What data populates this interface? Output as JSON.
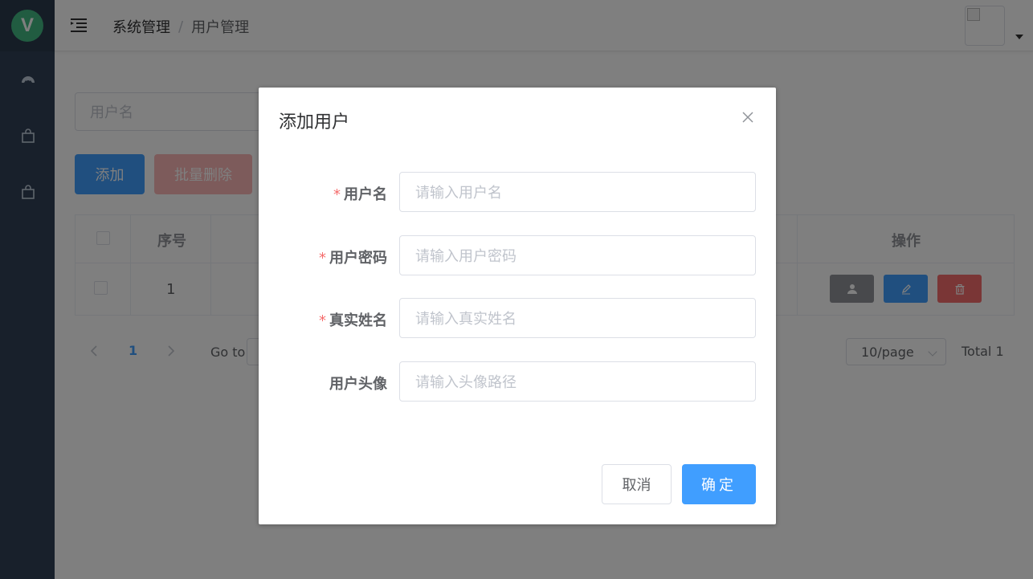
{
  "sidebar": {
    "logo_letter": "V",
    "items": [
      {
        "icon": "dashboard-icon"
      },
      {
        "icon": "shopping-bag-icon"
      },
      {
        "icon": "shopping-bag-icon"
      }
    ]
  },
  "header": {
    "breadcrumb": [
      "系统管理",
      "用户管理"
    ],
    "separator": "/"
  },
  "toolbar": {
    "search_placeholder": "用户名",
    "add_label": "添加",
    "batch_delete_label": "批量删除"
  },
  "table": {
    "columns": [
      "序号",
      "操作"
    ],
    "rows": [
      {
        "index": "1"
      }
    ]
  },
  "pagination": {
    "current_page": "1",
    "goto_label": "Go to",
    "page_size": "10/page",
    "total": "Total 1"
  },
  "dialog": {
    "title": "添加用户",
    "fields": [
      {
        "label": "用户名",
        "required": "*",
        "placeholder": "请输入用户名"
      },
      {
        "label": "用户密码",
        "required": "*",
        "placeholder": "请输入用户密码"
      },
      {
        "label": "真实姓名",
        "required": "*",
        "placeholder": "请输入真实姓名"
      },
      {
        "label": "用户头像",
        "required": "",
        "placeholder": "请输入头像路径"
      }
    ],
    "cancel_label": "取消",
    "ok_label": "确定"
  },
  "colors": {
    "sidebar_bg": "#304156",
    "primary": "#409eff",
    "danger": "#f56c6c",
    "info": "#909399",
    "logo": "#42b983"
  }
}
